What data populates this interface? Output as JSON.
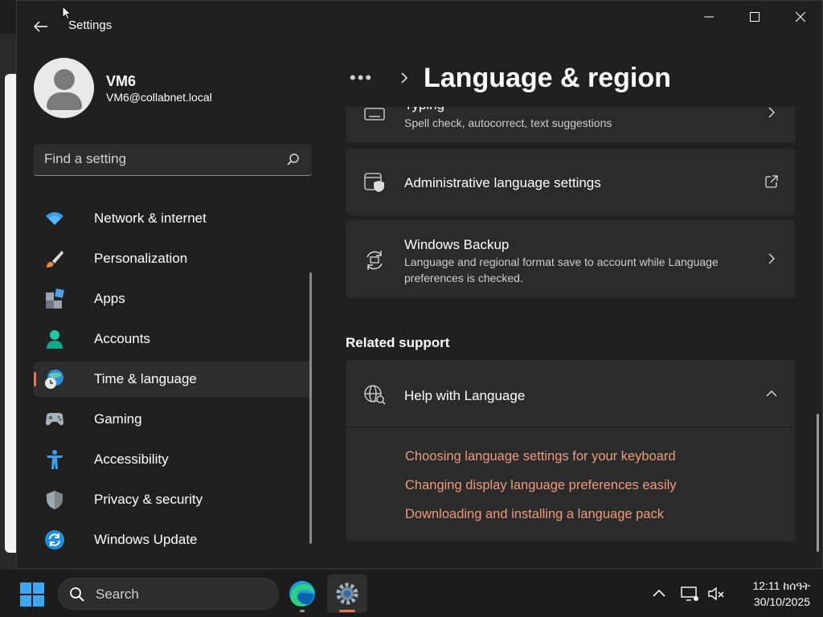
{
  "window": {
    "title": "Settings"
  },
  "profile": {
    "name": "VM6",
    "email": "VM6@collabnet.local"
  },
  "search": {
    "placeholder": "Find a setting"
  },
  "nav": {
    "items": [
      {
        "label": "Network & internet",
        "icon": "wifi-icon"
      },
      {
        "label": "Personalization",
        "icon": "brush-icon"
      },
      {
        "label": "Apps",
        "icon": "apps-icon"
      },
      {
        "label": "Accounts",
        "icon": "person-icon"
      },
      {
        "label": "Time & language",
        "icon": "globe-clock-icon",
        "selected": true
      },
      {
        "label": "Gaming",
        "icon": "gamepad-icon"
      },
      {
        "label": "Accessibility",
        "icon": "accessibility-icon"
      },
      {
        "label": "Privacy & security",
        "icon": "shield-icon"
      },
      {
        "label": "Windows Update",
        "icon": "update-icon"
      }
    ]
  },
  "breadcrumb": {
    "overflow": "•••",
    "title": "Language & region"
  },
  "main": {
    "typing": {
      "title": "Typing",
      "subtitle": "Spell check, autocorrect, text suggestions"
    },
    "admin": {
      "title": "Administrative language settings"
    },
    "backup": {
      "title": "Windows Backup",
      "subtitle": "Language and regional format save to account while Language preferences is checked."
    },
    "related_support": "Related support",
    "help": {
      "title": "Help with Language",
      "links": [
        "Choosing language settings for your keyboard",
        "Changing display language preferences easily",
        "Downloading and installing a language pack"
      ]
    }
  },
  "taskbar": {
    "search_label": "Search",
    "time": "12:11 ከሰዓት",
    "date": "30/10/2025"
  },
  "colors": {
    "accent": "#f0744f",
    "link": "#ef9a7b",
    "card": "#2b2b2b",
    "background": "#202020"
  }
}
